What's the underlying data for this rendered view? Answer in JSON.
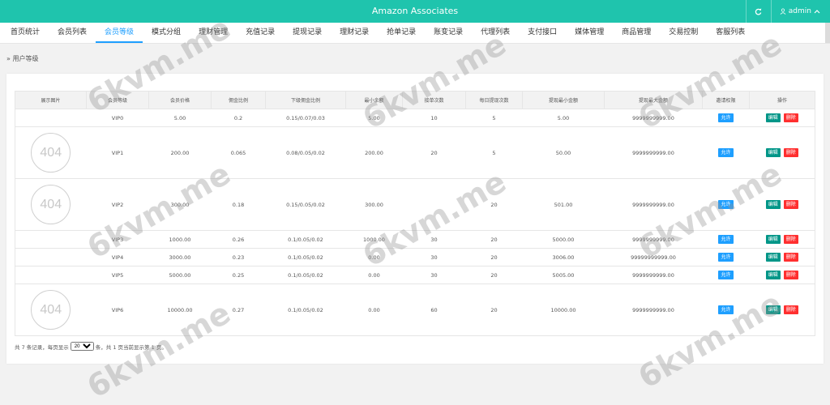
{
  "app": {
    "title": "Amazon Associates",
    "user": "admin"
  },
  "nav": {
    "tabs": [
      "首页统计",
      "会员列表",
      "会员等级",
      "模式分组",
      "理财管理",
      "充值记录",
      "提现记录",
      "理财记录",
      "抢单记录",
      "账变记录",
      "代理列表",
      "支付接口",
      "媒体管理",
      "商品管理",
      "交易控制",
      "客服列表"
    ],
    "active_index": 2
  },
  "breadcrumb": "用户等级",
  "table": {
    "headers": [
      "展示图片",
      "会员等级",
      "会员价格",
      "佣金比例",
      "下级佣金比例",
      "最小余额",
      "接单次数",
      "每日提现次数",
      "提现最小金额",
      "提现最大金额",
      "邀请权限",
      "操作"
    ],
    "rows": [
      {
        "img": "",
        "level": "VIP0",
        "price": "5.00",
        "rate": "0.2",
        "sub_rate": "0.15/0.07/0.03",
        "min_balance": "5.00",
        "orders": "10",
        "withdraw_times": "5",
        "min_withdraw": "5.00",
        "max_withdraw": "9999999999.00"
      },
      {
        "img": "404",
        "level": "VIP1",
        "price": "200.00",
        "rate": "0.065",
        "sub_rate": "0.08/0.05/0.02",
        "min_balance": "200.00",
        "orders": "20",
        "withdraw_times": "5",
        "min_withdraw": "50.00",
        "max_withdraw": "9999999999.00"
      },
      {
        "img": "404",
        "level": "VIP2",
        "price": "300.00",
        "rate": "0.18",
        "sub_rate": "0.15/0.05/0.02",
        "min_balance": "300.00",
        "orders": "",
        "withdraw_times": "20",
        "min_withdraw": "501.00",
        "max_withdraw": "9999999999.00"
      },
      {
        "img": "",
        "level": "VIP3",
        "price": "1000.00",
        "rate": "0.26",
        "sub_rate": "0.1/0.05/0.02",
        "min_balance": "1000.00",
        "orders": "30",
        "withdraw_times": "20",
        "min_withdraw": "5000.00",
        "max_withdraw": "9999999999.00"
      },
      {
        "img": "",
        "level": "VIP4",
        "price": "3000.00",
        "rate": "0.23",
        "sub_rate": "0.1/0.05/0.02",
        "min_balance": "0.00",
        "orders": "30",
        "withdraw_times": "20",
        "min_withdraw": "3006.00",
        "max_withdraw": "99999999999.00"
      },
      {
        "img": "",
        "level": "VIP5",
        "price": "5000.00",
        "rate": "0.25",
        "sub_rate": "0.1/0.05/0.02",
        "min_balance": "0.00",
        "orders": "30",
        "withdraw_times": "20",
        "min_withdraw": "5005.00",
        "max_withdraw": "9999999999.00"
      },
      {
        "img": "404",
        "level": "VIP6",
        "price": "10000.00",
        "rate": "0.27",
        "sub_rate": "0.1/0.05/0.02",
        "min_balance": "0.00",
        "orders": "60",
        "withdraw_times": "20",
        "min_withdraw": "10000.00",
        "max_withdraw": "9999999999.00"
      }
    ],
    "allow_label": "允许",
    "edit_label": "编辑",
    "delete_label": "删除"
  },
  "pager": {
    "prefix": "共 7 条记录，每页显示",
    "page_size": "20",
    "suffix": "条，共 1 页当前显示第 1 页。"
  },
  "watermark": "6kvm.me",
  "icons": {
    "refresh": "refresh-icon",
    "user": "user-icon",
    "chevron": "chevron-up-icon",
    "breadcrumb": "double-chevron-right-icon"
  },
  "colors": {
    "topbar": "#1fc4ad",
    "active_tab": "#1e9fff",
    "allow": "#1e9fff",
    "edit": "#009688",
    "delete": "#ff2f2f",
    "price": "#5fb878"
  }
}
